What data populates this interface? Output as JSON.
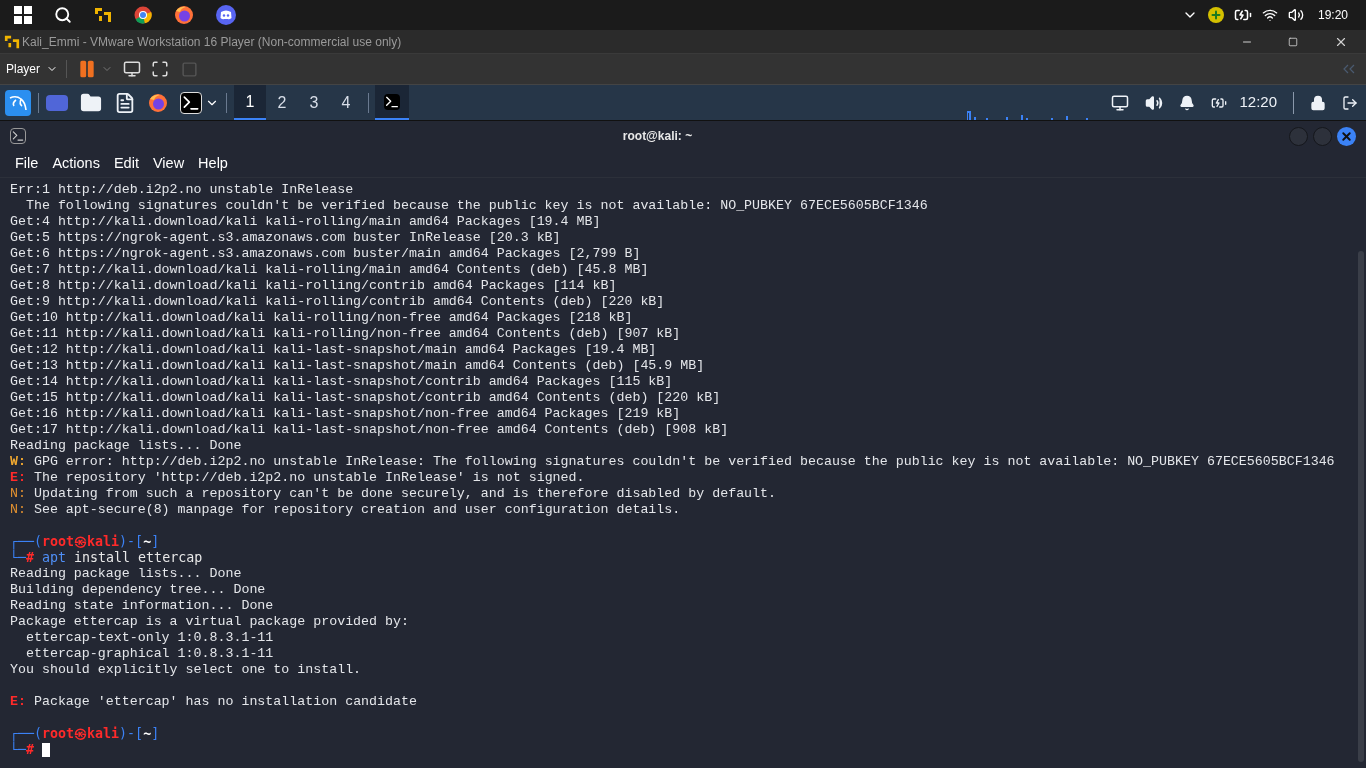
{
  "taskbar": {
    "clock": "19:20"
  },
  "vm_window": {
    "title": "Kali_Emmi - VMware Workstation 16 Player (Non-commercial use only)",
    "menu": "Player"
  },
  "kali_panel": {
    "workspaces": [
      {
        "label": "1",
        "selected": true
      },
      {
        "label": "2",
        "selected": false
      },
      {
        "label": "3",
        "selected": false
      },
      {
        "label": "4",
        "selected": false
      }
    ],
    "clock": "12:20"
  },
  "terminal": {
    "title": "root@kali: ~",
    "menu": [
      "File",
      "Actions",
      "Edit",
      "View",
      "Help"
    ],
    "lines": [
      {
        "kind": "text",
        "text": "Err:1 http://deb.i2p2.no unstable InRelease"
      },
      {
        "kind": "text",
        "text": "  The following signatures couldn't be verified because the public key is not available: NO_PUBKEY 67ECE5605BCF1346"
      },
      {
        "kind": "text",
        "text": "Get:4 http://kali.download/kali kali-rolling/main amd64 Packages [19.4 MB]"
      },
      {
        "kind": "text",
        "text": "Get:5 https://ngrok-agent.s3.amazonaws.com buster InRelease [20.3 kB]"
      },
      {
        "kind": "text",
        "text": "Get:6 https://ngrok-agent.s3.amazonaws.com buster/main amd64 Packages [2,799 B]"
      },
      {
        "kind": "text",
        "text": "Get:7 http://kali.download/kali kali-rolling/main amd64 Contents (deb) [45.8 MB]"
      },
      {
        "kind": "text",
        "text": "Get:8 http://kali.download/kali kali-rolling/contrib amd64 Packages [114 kB]"
      },
      {
        "kind": "text",
        "text": "Get:9 http://kali.download/kali kali-rolling/contrib amd64 Contents (deb) [220 kB]"
      },
      {
        "kind": "text",
        "text": "Get:10 http://kali.download/kali kali-rolling/non-free amd64 Packages [218 kB]"
      },
      {
        "kind": "text",
        "text": "Get:11 http://kali.download/kali kali-rolling/non-free amd64 Contents (deb) [907 kB]"
      },
      {
        "kind": "text",
        "text": "Get:12 http://kali.download/kali kali-last-snapshot/main amd64 Packages [19.4 MB]"
      },
      {
        "kind": "text",
        "text": "Get:13 http://kali.download/kali kali-last-snapshot/main amd64 Contents (deb) [45.9 MB]"
      },
      {
        "kind": "text",
        "text": "Get:14 http://kali.download/kali kali-last-snapshot/contrib amd64 Packages [115 kB]"
      },
      {
        "kind": "text",
        "text": "Get:15 http://kali.download/kali kali-last-snapshot/contrib amd64 Contents (deb) [220 kB]"
      },
      {
        "kind": "text",
        "text": "Get:16 http://kali.download/kali kali-last-snapshot/non-free amd64 Packages [219 kB]"
      },
      {
        "kind": "text",
        "text": "Get:17 http://kali.download/kali kali-last-snapshot/non-free amd64 Contents (deb) [908 kB]"
      },
      {
        "kind": "text",
        "text": "Reading package lists... Done"
      },
      {
        "kind": "warning",
        "prefix": "W:",
        "text": " GPG error: http://deb.i2p2.no unstable InRelease: The following signatures couldn't be verified because the public key is not available: NO_PUBKEY 67ECE5605BCF1346"
      },
      {
        "kind": "error",
        "prefix": "E:",
        "text": " The repository 'http://deb.i2p2.no unstable InRelease' is not signed."
      },
      {
        "kind": "notice",
        "prefix": "N:",
        "text": " Updating from such a repository can't be done securely, and is therefore disabled by default."
      },
      {
        "kind": "notice",
        "prefix": "N:",
        "text": " See apt-secure(8) manpage for repository creation and user configuration details."
      },
      {
        "kind": "blank"
      },
      {
        "kind": "prompt",
        "top": "┌──(",
        "user": "root",
        "at": "㉿",
        "host": "kali",
        "mid": ")-[",
        "dir": "~",
        "close": "]",
        "bottom": "└─",
        "symbol": "#",
        "program": "apt",
        "args": " install ettercap",
        "cursor": false
      },
      {
        "kind": "text",
        "text": "Reading package lists... Done"
      },
      {
        "kind": "text",
        "text": "Building dependency tree... Done"
      },
      {
        "kind": "text",
        "text": "Reading state information... Done"
      },
      {
        "kind": "text",
        "text": "Package ettercap is a virtual package provided by:"
      },
      {
        "kind": "text",
        "text": "  ettercap-text-only 1:0.8.3.1-11"
      },
      {
        "kind": "text",
        "text": "  ettercap-graphical 1:0.8.3.1-11"
      },
      {
        "kind": "text",
        "text": "You should explicitly select one to install."
      },
      {
        "kind": "blank"
      },
      {
        "kind": "error",
        "prefix": "E:",
        "text": " Package 'ettercap' has no installation candidate"
      },
      {
        "kind": "blank"
      },
      {
        "kind": "prompt",
        "top": "┌──(",
        "user": "root",
        "at": "㉿",
        "host": "kali",
        "mid": ")-[",
        "dir": "~",
        "close": "]",
        "bottom": "└─",
        "symbol": "#",
        "cursor": true
      }
    ]
  }
}
